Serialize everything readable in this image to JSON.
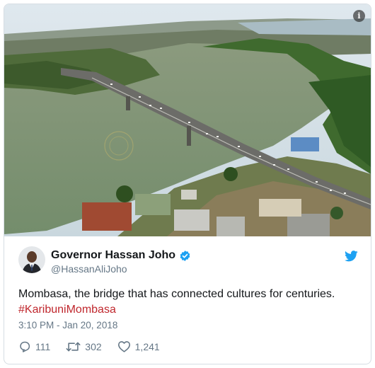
{
  "media": {
    "description_icon": "info-icon",
    "info_glyph": "i"
  },
  "author": {
    "display_name": "Governor Hassan Joho",
    "handle": "@HassanAliJoho",
    "verified_icon": "verified-badge-icon",
    "brand_icon": "twitter-bird-icon"
  },
  "tweet": {
    "text": "Mombasa, the bridge that has connected cultures for centuries.",
    "hashtag": "#KaribuniMombasa",
    "timestamp": "3:10 PM - Jan 20, 2018"
  },
  "actions": {
    "replies": "111",
    "retweets": "302",
    "likes": "1,241"
  },
  "colors": {
    "accent": "#1da1f2",
    "hashtag": "#c0272d",
    "muted": "#657786",
    "text": "#14171a"
  }
}
